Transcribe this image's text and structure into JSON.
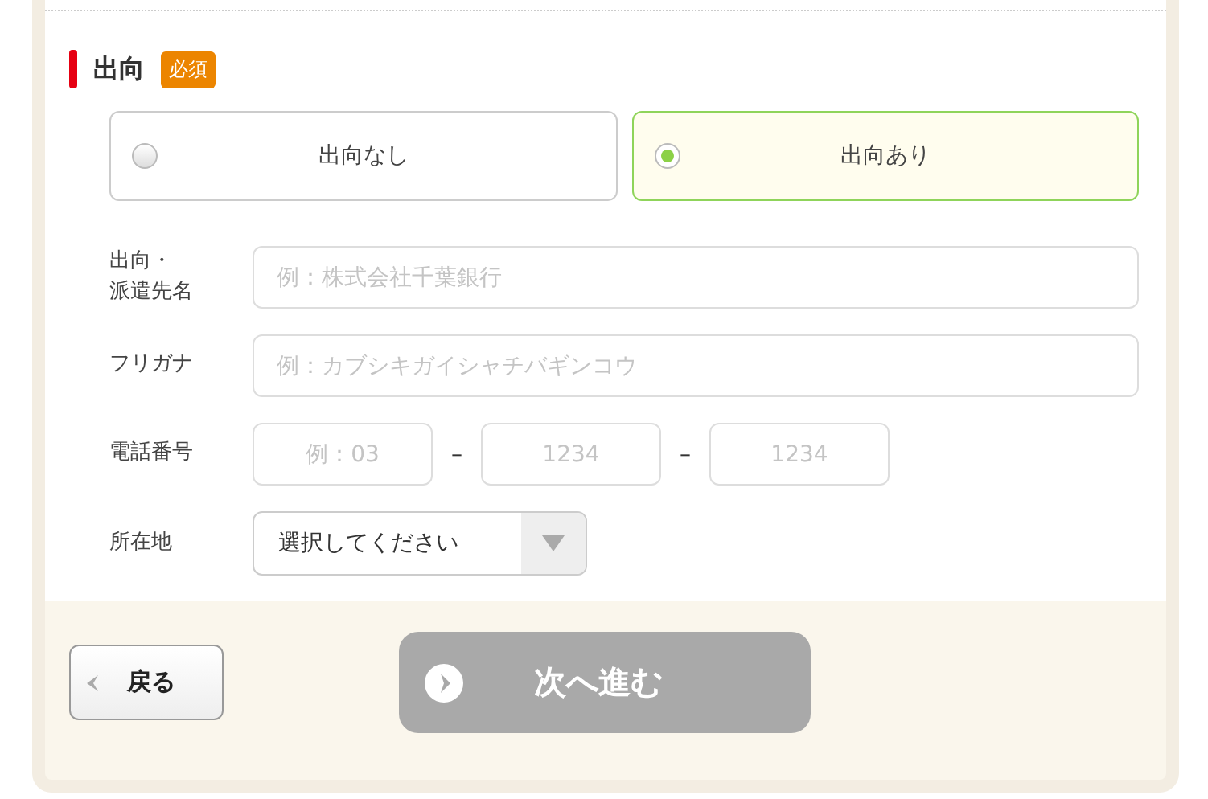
{
  "section": {
    "title": "出向",
    "badge": "必須"
  },
  "options": [
    {
      "label": "出向なし",
      "selected": false
    },
    {
      "label": "出向あり",
      "selected": true
    }
  ],
  "fields": [
    {
      "label": [
        "出向・",
        "派遣先名"
      ],
      "placeholder": "例：株式会社千葉銀行"
    },
    {
      "label": [
        "フリガナ"
      ],
      "placeholder": "例：カブシキガイシャチバギンコウ"
    }
  ],
  "phone": {
    "label": "電話番号",
    "parts": [
      {
        "placeholder": "例：03"
      },
      {
        "placeholder": "1234"
      },
      {
        "placeholder": "1234"
      }
    ],
    "separator": "–"
  },
  "location": {
    "label": "所在地",
    "value": "選択してください"
  },
  "buttons": {
    "back": "戻る",
    "next": {
      "label": "次へ進む",
      "disabled": true
    }
  }
}
